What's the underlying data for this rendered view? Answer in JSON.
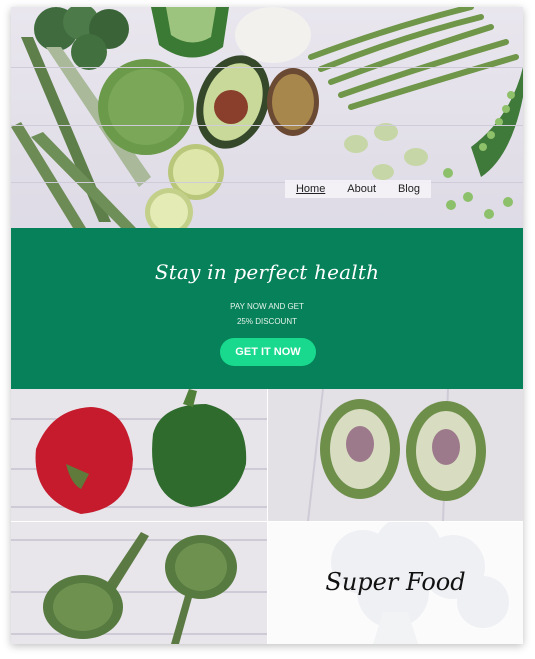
{
  "nav": {
    "items": [
      {
        "label": "Home",
        "active": true
      },
      {
        "label": "About",
        "active": false
      },
      {
        "label": "Blog",
        "active": false
      }
    ]
  },
  "banner": {
    "tagline": "Stay in perfect health",
    "promo_line1": "PAY NOW AND GET",
    "promo_line2": "25% DISCOUNT",
    "cta_label": "GET IT NOW"
  },
  "tiles": {
    "superfood_label": "Super Food"
  },
  "colors": {
    "banner_green": "#078159",
    "cta_green": "#18d98d"
  }
}
